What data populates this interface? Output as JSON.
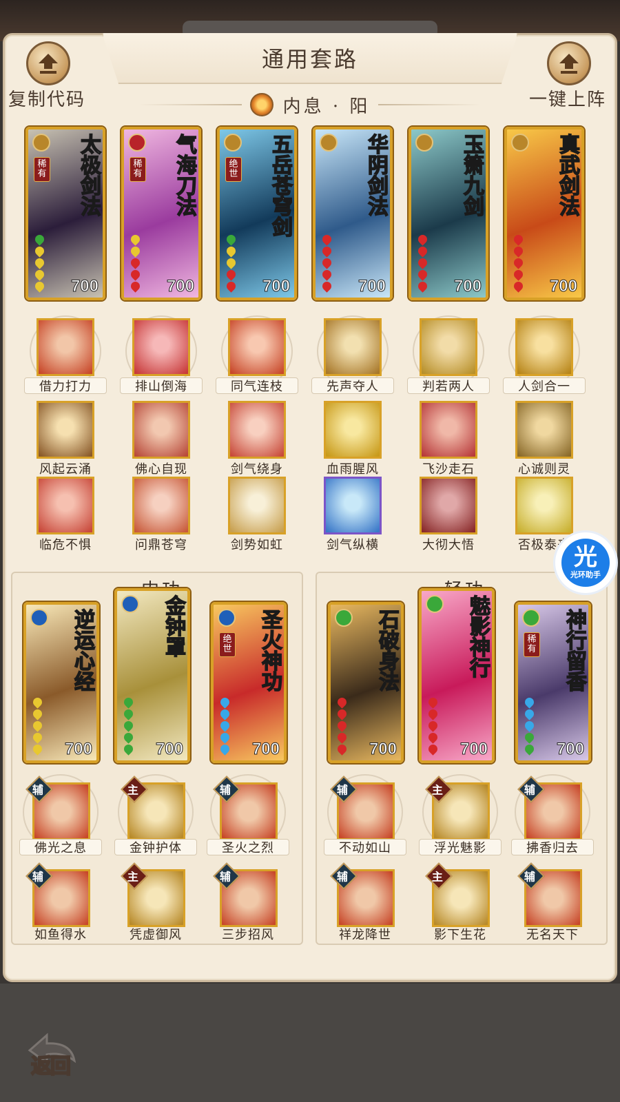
{
  "header": {
    "title": "通用套路",
    "subtitle": "内息 · 阳",
    "copy_code_label": "复制代码",
    "deploy_label": "一键上阵"
  },
  "top_cards": [
    {
      "name": "太极剑法",
      "score": "700",
      "rarity": "稀有",
      "colors": [
        "#2b1d3a",
        "#c8c2b2"
      ]
    },
    {
      "name": "气海刀法",
      "score": "700",
      "rarity": "稀有",
      "colors": [
        "#9a3b9e",
        "#f0b7e0"
      ]
    },
    {
      "name": "五岳苍穹剑",
      "score": "700",
      "rarity": "绝世",
      "colors": [
        "#123a5a",
        "#7ec8e8"
      ]
    },
    {
      "name": "华阴剑法",
      "score": "700",
      "rarity": "",
      "colors": [
        "#2f5a8a",
        "#c8e6f8"
      ]
    },
    {
      "name": "玉箫九剑",
      "score": "700",
      "rarity": "",
      "colors": [
        "#1b3a4a",
        "#8cc8c8"
      ]
    },
    {
      "name": "真武剑法",
      "score": "700",
      "rarity": "",
      "colors": [
        "#c84a18",
        "#f8c848"
      ]
    }
  ],
  "top_skills_row1": [
    "借力打力",
    "排山倒海",
    "同气连枝",
    "先声夺人",
    "判若两人",
    "人剑合一"
  ],
  "top_skills_row2": [
    "风起云涌",
    "佛心自现",
    "剑气绕身",
    "血雨腥风",
    "飞沙走石",
    "心诚则灵"
  ],
  "top_skills_row3": [
    "临危不惧",
    "问鼎苍穹",
    "剑势如虹",
    "剑气纵横",
    "大彻大悟",
    "否极泰来"
  ],
  "neigong": {
    "title": "内功",
    "cards": [
      {
        "name": "逆运心经",
        "score": "700",
        "rarity": ""
      },
      {
        "name": "金钟罩",
        "score": "700",
        "rarity": ""
      },
      {
        "name": "圣火神功",
        "score": "700",
        "rarity": "绝世"
      }
    ],
    "skills_row1": [
      {
        "tag": "辅",
        "label": "佛光之息"
      },
      {
        "tag": "主",
        "label": "金钟护体"
      },
      {
        "tag": "辅",
        "label": "圣火之烈"
      }
    ],
    "skills_row2": [
      {
        "tag": "辅",
        "label": "如鱼得水"
      },
      {
        "tag": "主",
        "label": "凭虚御风"
      },
      {
        "tag": "辅",
        "label": "三步招风"
      }
    ]
  },
  "qinggong": {
    "title": "轻功",
    "cards": [
      {
        "name": "石破身法",
        "score": "700",
        "rarity": ""
      },
      {
        "name": "魅影神行",
        "score": "700",
        "rarity": ""
      },
      {
        "name": "神行留香",
        "score": "700",
        "rarity": "稀有"
      }
    ],
    "skills_row1": [
      {
        "tag": "辅",
        "label": "不动如山"
      },
      {
        "tag": "主",
        "label": "浮光魅影"
      },
      {
        "tag": "辅",
        "label": "拂香归去"
      }
    ],
    "skills_row2": [
      {
        "tag": "辅",
        "label": "祥龙降世"
      },
      {
        "tag": "主",
        "label": "影下生花"
      },
      {
        "tag": "辅",
        "label": "无名天下"
      }
    ]
  },
  "helper": {
    "glyph": "光",
    "label": "光环助手"
  },
  "back_label": "返回"
}
